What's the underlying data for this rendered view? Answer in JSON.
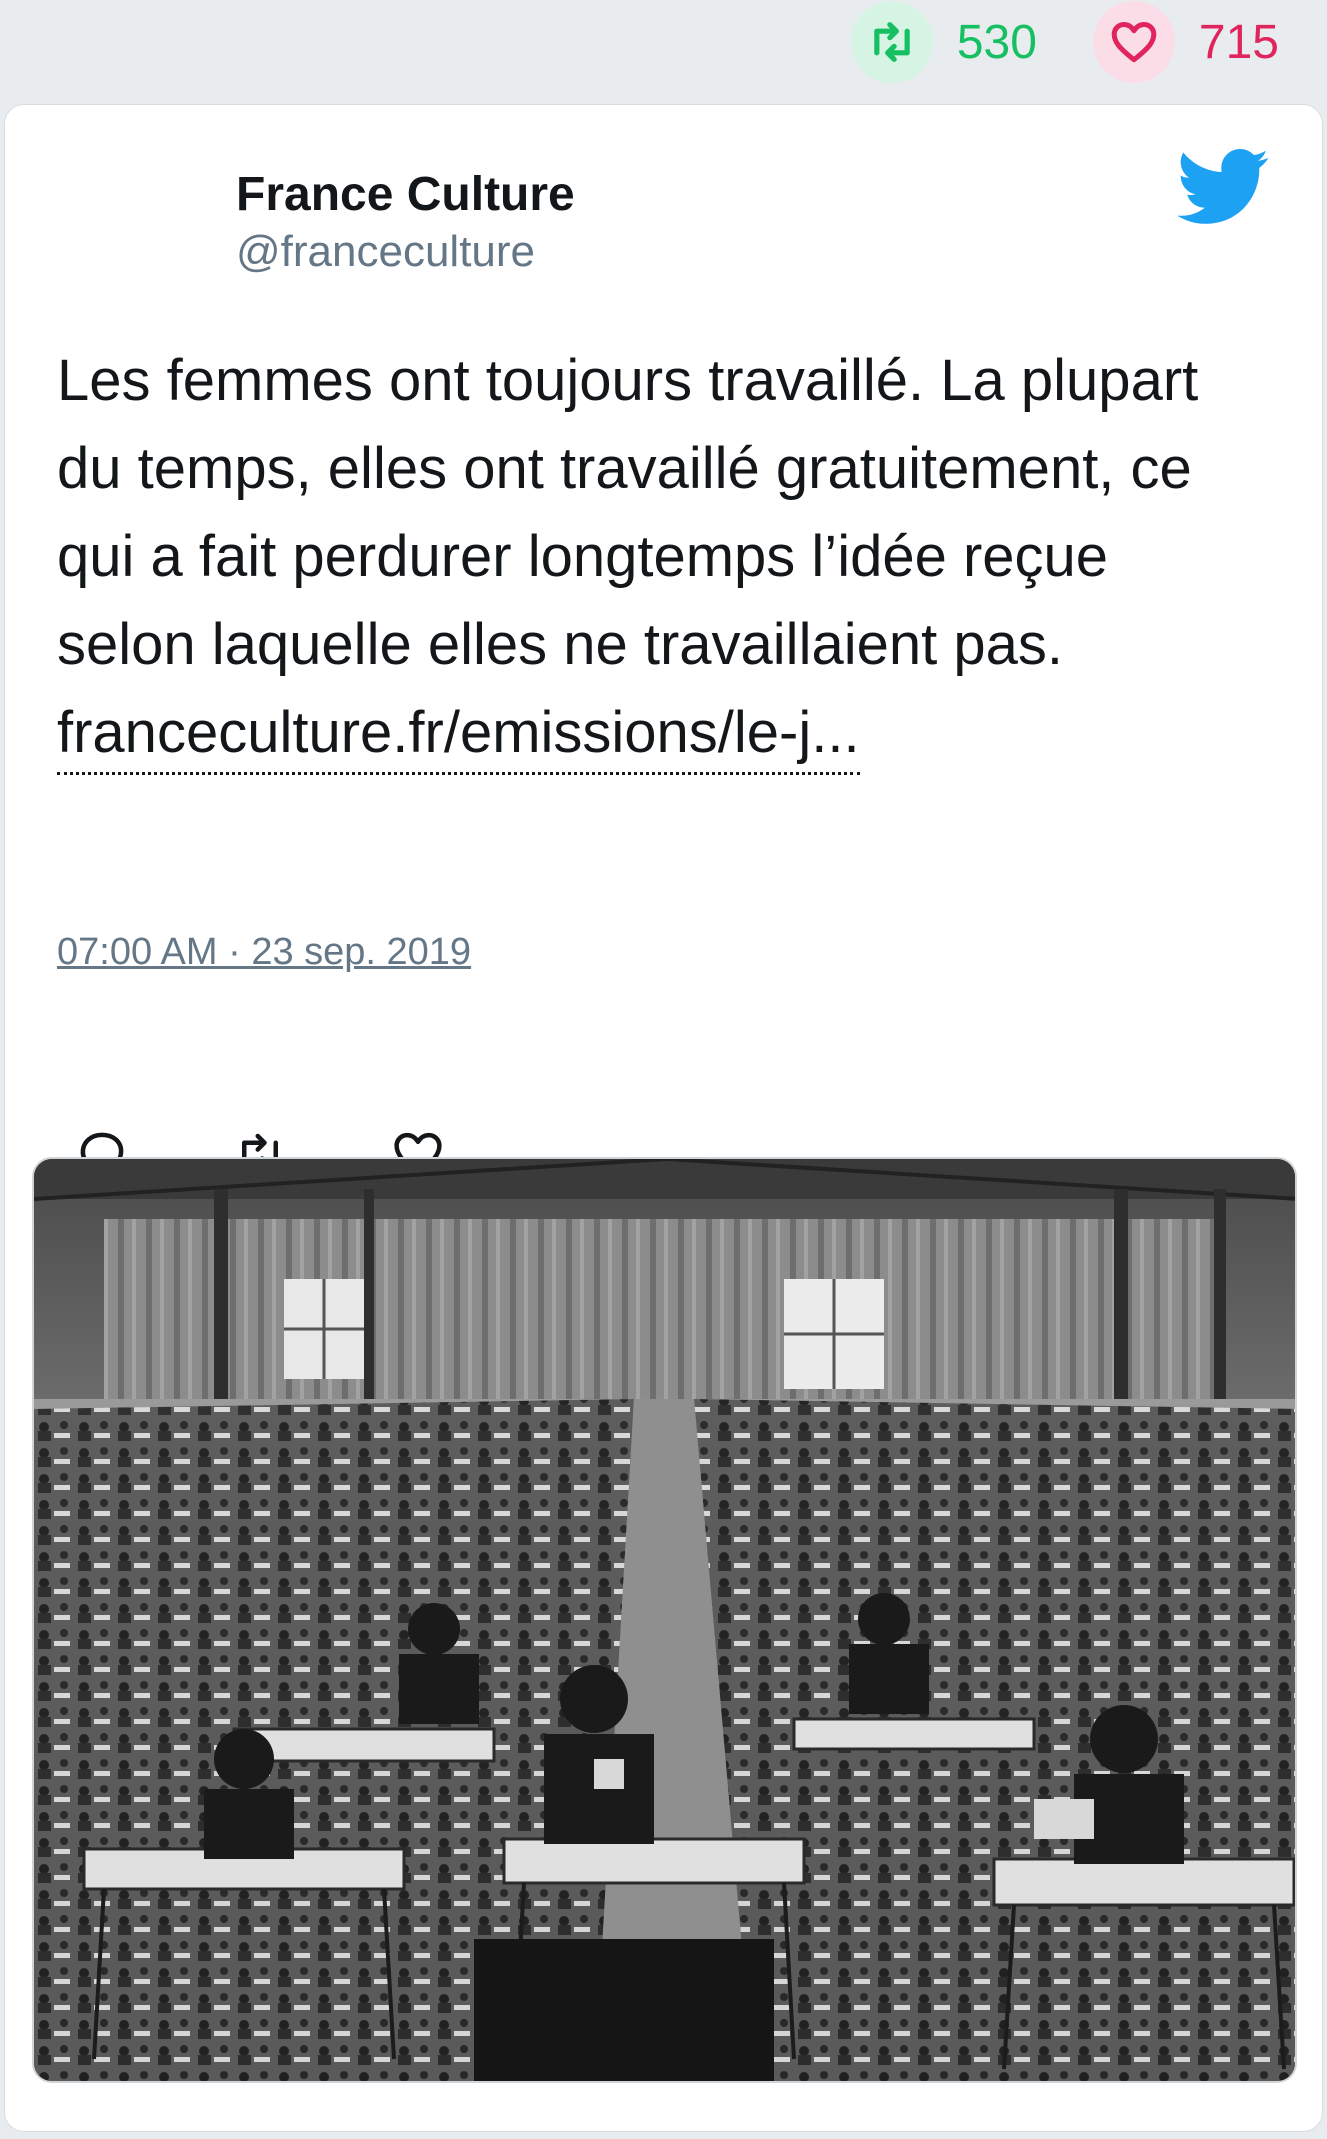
{
  "stats": {
    "retweets": "530",
    "likes": "715",
    "retweet_icon": "retweet-icon",
    "like_icon": "heart-icon"
  },
  "tweet": {
    "author_name": "France Culture",
    "author_handle": "@franceculture",
    "text": "Les femmes ont toujours travaillé. La plupart du temps, elles ont travaillé gratuitement, ce qui a fait perdurer longtemps l’idée reçue selon laquelle elles ne travaillaient pas.",
    "link": "franceculture.fr/emissions/le-j...",
    "timestamp": "07:00 AM · 23 sep. 2019",
    "platform_icon": "twitter-bird-icon"
  },
  "actions": [
    "reply-icon",
    "retweet-icon",
    "like-icon"
  ],
  "colors": {
    "retweet_green": "#17bf63",
    "like_red": "#e0245e",
    "twitter_blue": "#1da1f2",
    "text_gray": "#657786"
  }
}
